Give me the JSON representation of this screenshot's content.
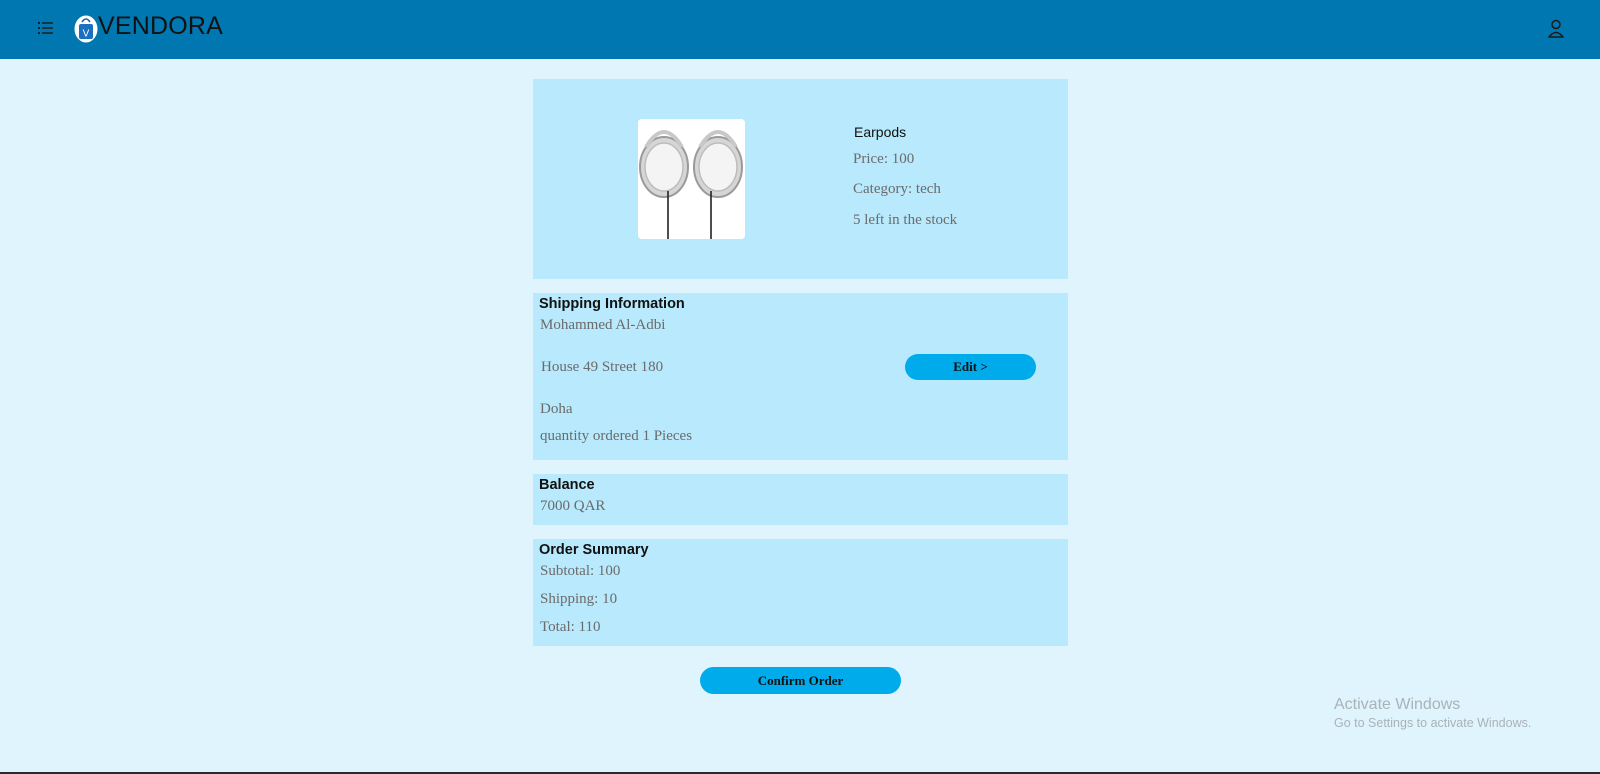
{
  "header": {
    "brand": "VENDORA",
    "logo_letter": "V",
    "icons": {
      "menu": "list-menu-icon",
      "user": "user-account-icon"
    },
    "background": "#0077b0"
  },
  "product": {
    "name": "Earpods",
    "price": "Price: 100",
    "category": "Category: tech",
    "stock": "5 left in the stock"
  },
  "shipping": {
    "heading": "Shipping Information",
    "name": "Mohammed Al-Adbi",
    "address": "House 49 Street 180",
    "city": "Doha",
    "quantity": "quantity ordered 1 Pieces",
    "edit_label": "Edit >"
  },
  "balance": {
    "heading": "Balance",
    "amount": "7000 QAR"
  },
  "summary": {
    "heading": "Order Summary",
    "subtotal": "Subtotal: 100",
    "shipping": "Shipping: 10",
    "total": "Total: 110"
  },
  "actions": {
    "confirm_label": "Confirm Order"
  },
  "watermark": {
    "title": "Activate Windows",
    "subtitle": "Go to Settings to activate Windows."
  },
  "colors": {
    "page_bg": "#dff4fd",
    "panel_bg": "#b8e9fc",
    "button": "#00abeb"
  }
}
